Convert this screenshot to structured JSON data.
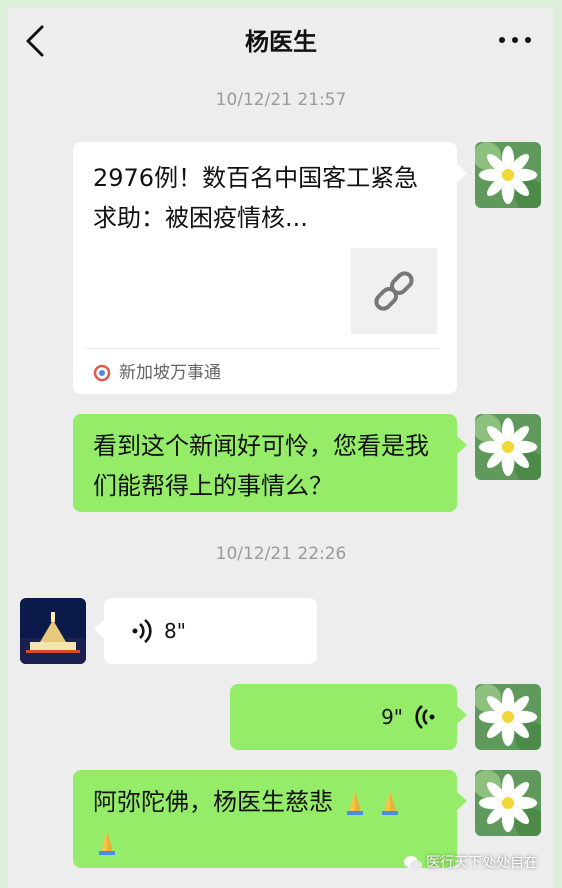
{
  "header": {
    "back_icon": "chevron-left-icon",
    "title": "杨医生",
    "more_icon": "ellipsis-icon"
  },
  "messages": {
    "ts1": "10/12/21 21:57",
    "card": {
      "title": "2976例！数百名中国客工紧急求助：被困疫情核...",
      "source": "新加坡万事通",
      "thumb_icon": "link-icon"
    },
    "msg2": "看到这个新闻好可怜，您看是我们能帮得上的事情么？",
    "ts2": "10/12/21 22:26",
    "voice_in": "8\"",
    "voice_out": "9\"",
    "msg5": "阿弥陀佛，杨医生慈悲"
  },
  "watermark": "医行天下处处自在",
  "colors": {
    "bubble_green": "#95ec69",
    "bubble_white": "#ffffff",
    "background": "#ededed"
  }
}
